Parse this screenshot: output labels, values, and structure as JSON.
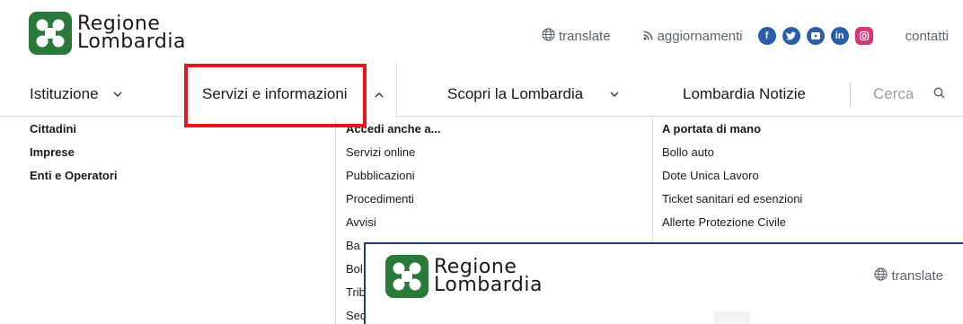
{
  "brand": {
    "line1": "Regione",
    "line2": "Lombardia",
    "mark_color": "#297a38"
  },
  "toplinks": {
    "translate": "translate",
    "aggiornamenti": "aggiornamenti",
    "contatti": "contatti",
    "social": [
      "facebook-icon",
      "twitter-icon",
      "youtube-icon",
      "linkedin-icon",
      "instagram-icon"
    ]
  },
  "nav": {
    "items": [
      {
        "label": "Istituzione"
      },
      {
        "label": "Servizi e informazioni"
      },
      {
        "label": "Scopri la Lombardia"
      },
      {
        "label": "Lombardia Notizie"
      }
    ],
    "search_label": "Cerca"
  },
  "menu": {
    "col1": [
      "Cittadini",
      "Imprese",
      "Enti e Operatori"
    ],
    "col2_title": "Accedi anche a...",
    "col2": [
      "Servizi online",
      "Pubblicazioni",
      "Procedimenti",
      "Avvisi"
    ],
    "col2_fragments": [
      "Ba",
      "Bol",
      "Trib",
      "Seq"
    ],
    "col3_title": "A portata di mano",
    "col3": [
      "Bollo auto",
      "Dote Unica Lavoro",
      "Ticket sanitari ed esenzioni",
      "Allerte Protezione Civile"
    ]
  },
  "overlay": {
    "line1": "Regione",
    "line2": "Lombardia",
    "translate": "translate"
  },
  "colors": {
    "highlight": "#e8141e",
    "social_blue": "#2b5ea8",
    "instagram": "#d8327a"
  }
}
